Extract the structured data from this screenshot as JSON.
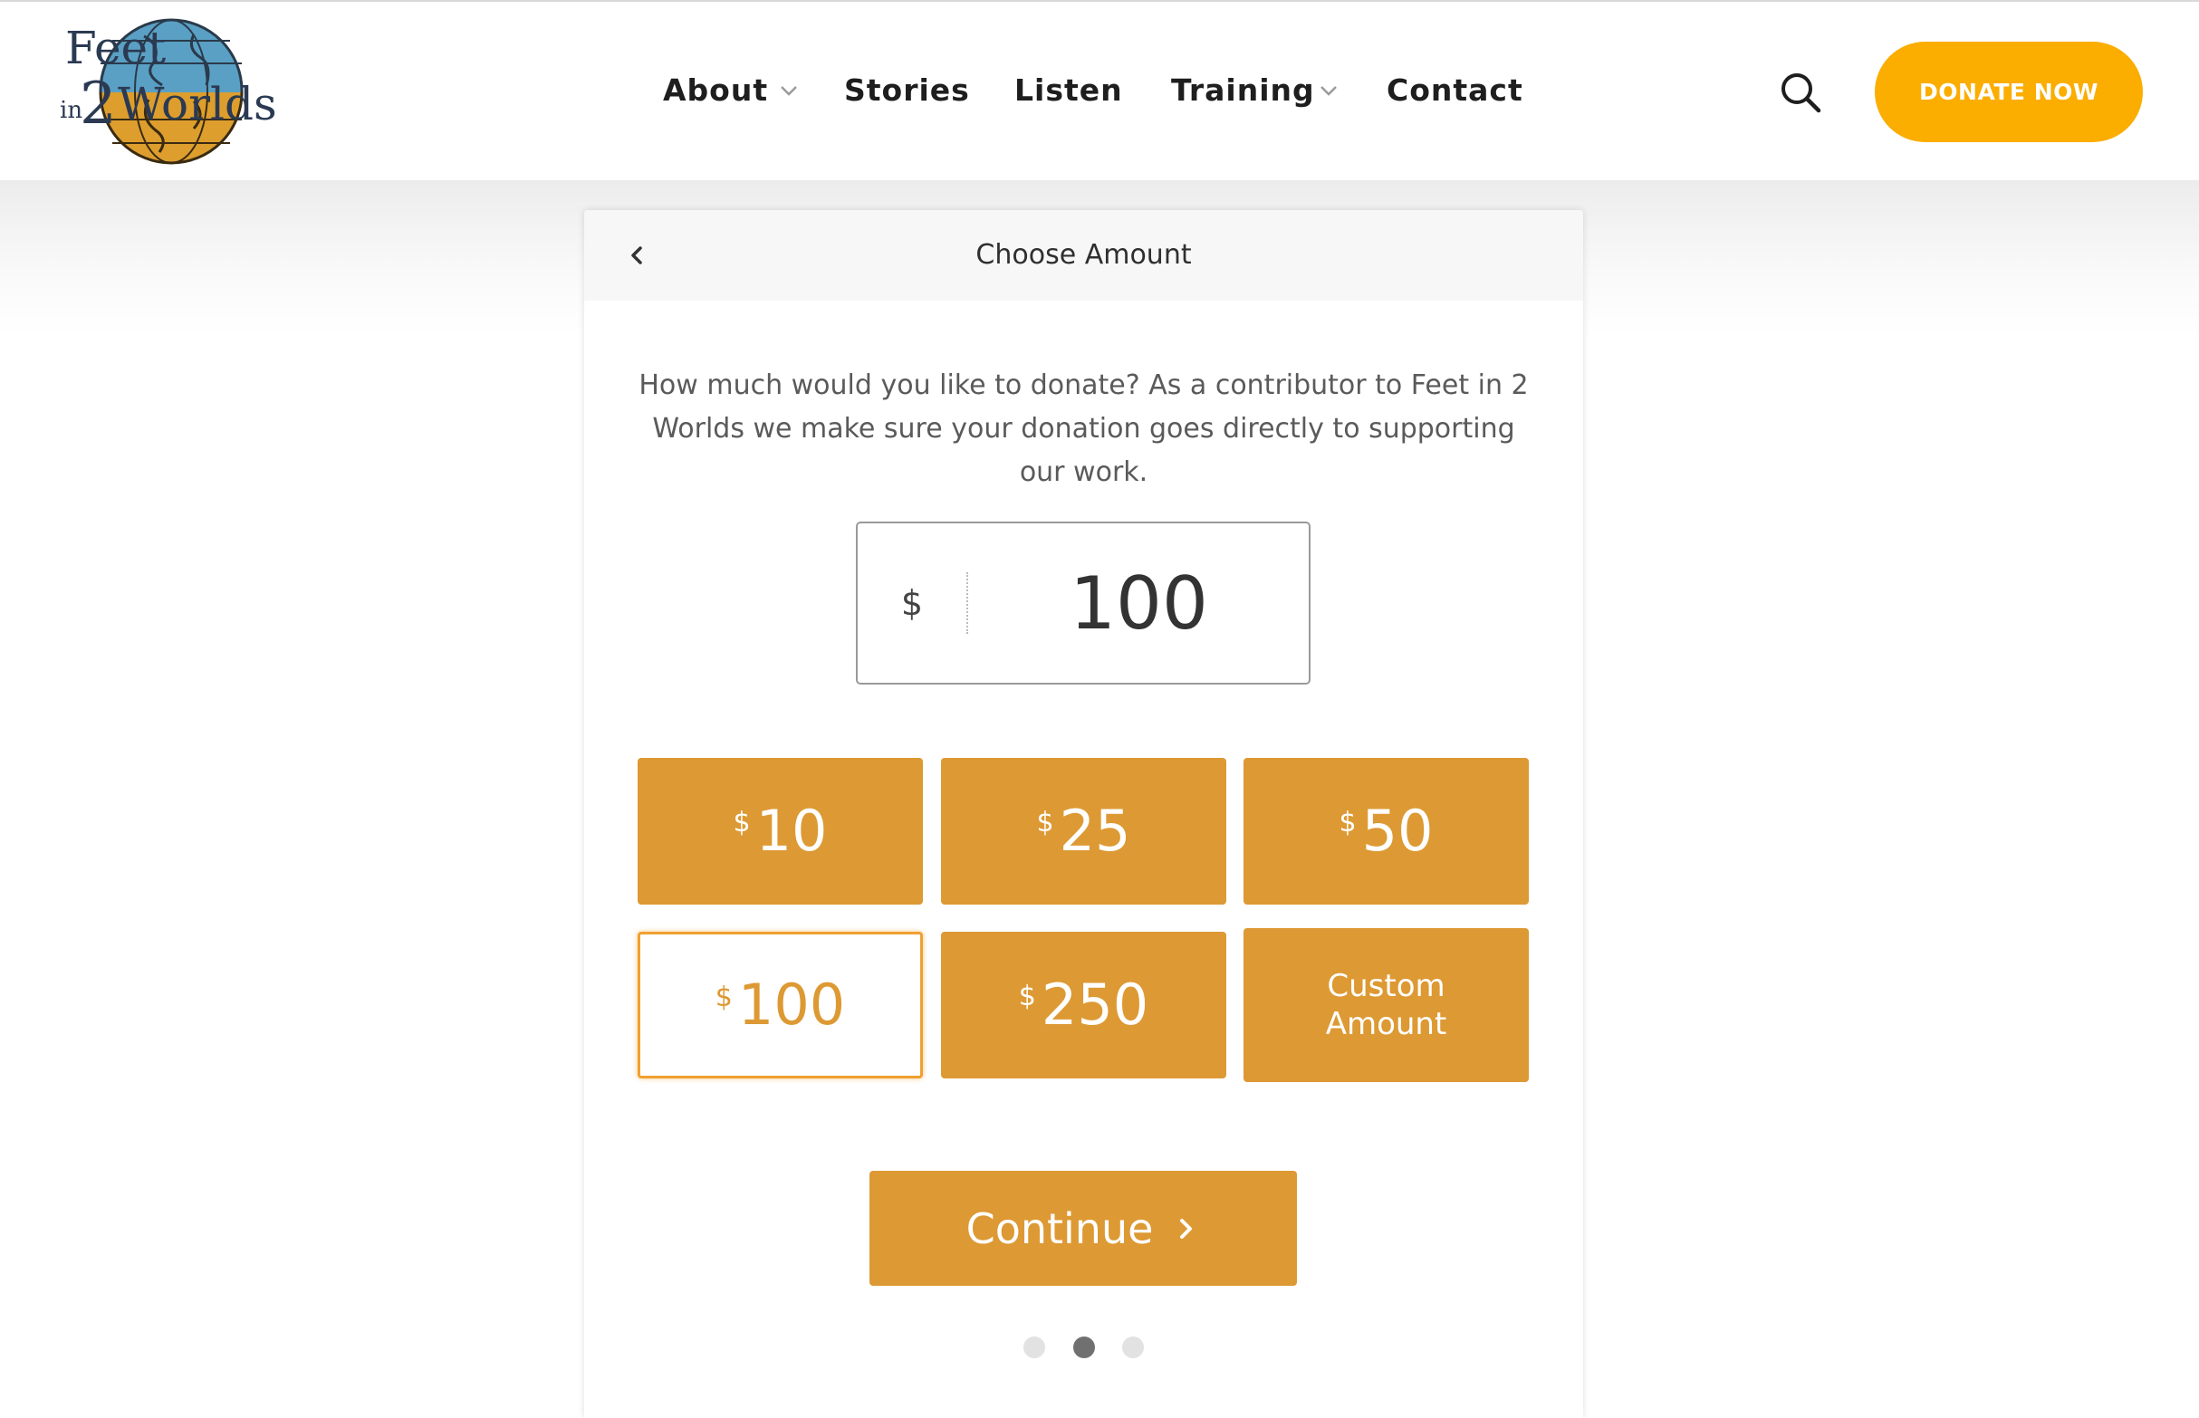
{
  "site": {
    "logo_text": "Feet in 2 Worlds"
  },
  "nav": {
    "items": [
      {
        "label": "About",
        "has_dropdown": true
      },
      {
        "label": "Stories",
        "has_dropdown": false
      },
      {
        "label": "Listen",
        "has_dropdown": false
      },
      {
        "label": "Training",
        "has_dropdown": true
      },
      {
        "label": "Contact",
        "has_dropdown": false
      }
    ],
    "search_icon": "search-icon",
    "donate_label": "DONATE NOW"
  },
  "donation_form": {
    "title": "Choose Amount",
    "back_icon": "chevron-left-icon",
    "intro": "How much would you like to donate? As a contributor to Feet in 2 Worlds we make sure your donation goes directly to supporting our work.",
    "currency_symbol": "$",
    "amount_value": "100",
    "levels": [
      {
        "symbol": "$",
        "amount": "10",
        "selected": false
      },
      {
        "symbol": "$",
        "amount": "25",
        "selected": false
      },
      {
        "symbol": "$",
        "amount": "50",
        "selected": false
      },
      {
        "symbol": "$",
        "amount": "100",
        "selected": true
      },
      {
        "symbol": "$",
        "amount": "250",
        "selected": false
      }
    ],
    "custom_label": "Custom Amount",
    "continue_label": "Continue",
    "continue_icon": "chevron-right-icon",
    "steps": {
      "total": 3,
      "current": 2
    }
  },
  "colors": {
    "donate_button": "#fbad00",
    "level_fill": "#dd9933",
    "level_selected_border": "#f0a030",
    "step_active": "#707070",
    "step_inactive": "#e2e2e2"
  }
}
